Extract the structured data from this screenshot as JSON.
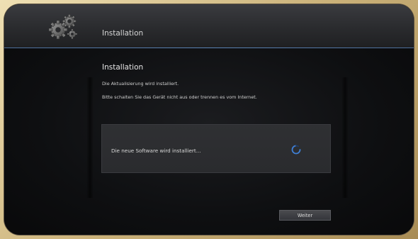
{
  "header": {
    "title": "Installation",
    "icon": "gear-cluster-icon"
  },
  "content": {
    "title": "Installation",
    "line1": "Die Aktualisierung wird installiert.",
    "line2": "Bitte schalten Sie das Gerät nicht aus oder trennen es vom Internet."
  },
  "status": {
    "text": "Die neue Software wird installiert...",
    "spinner_icon": "loading-spinner-icon",
    "spinner_color": "#3f7fd6"
  },
  "actions": {
    "next_label": "Weiter"
  },
  "colors": {
    "accent_line": "#5d86b8",
    "screen_bg": "#0d0e10",
    "bezel": "#d8c79a"
  }
}
